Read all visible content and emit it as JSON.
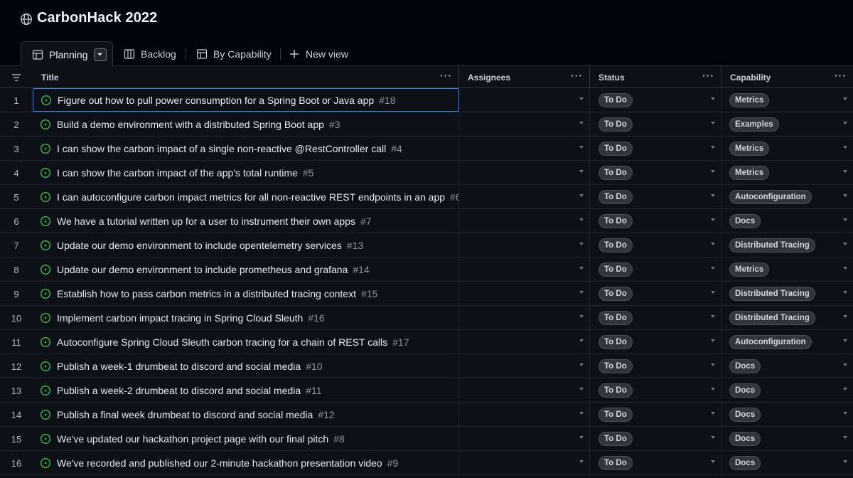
{
  "project": {
    "title": "CarbonHack 2022"
  },
  "tabs": [
    {
      "label": "Planning"
    },
    {
      "label": "Backlog"
    },
    {
      "label": "By Capability"
    },
    {
      "label": "New view"
    }
  ],
  "columns": {
    "title": "Title",
    "assignees": "Assignees",
    "status": "Status",
    "capability": "Capability"
  },
  "rows": [
    {
      "n": "1",
      "title": "Figure out how to pull power consumption for a Spring Boot or Java app",
      "issue": "#18",
      "status": "To Do",
      "capability": "Metrics"
    },
    {
      "n": "2",
      "title": "Build a demo environment with a distributed Spring Boot app",
      "issue": "#3",
      "status": "To Do",
      "capability": "Examples"
    },
    {
      "n": "3",
      "title": "I can show the carbon impact of a single non-reactive @RestController call",
      "issue": "#4",
      "status": "To Do",
      "capability": "Metrics"
    },
    {
      "n": "4",
      "title": "I can show the carbon impact of the app's total runtime",
      "issue": "#5",
      "status": "To Do",
      "capability": "Metrics"
    },
    {
      "n": "5",
      "title": "I can autoconfigure carbon impact metrics for all non-reactive REST endpoints in an app",
      "issue": "#6",
      "status": "To Do",
      "capability": "Autoconfiguration"
    },
    {
      "n": "6",
      "title": "We have a tutorial written up for a user to instrument their own apps",
      "issue": "#7",
      "status": "To Do",
      "capability": "Docs"
    },
    {
      "n": "7",
      "title": "Update our demo environment to include opentelemetry services",
      "issue": "#13",
      "status": "To Do",
      "capability": "Distributed Tracing"
    },
    {
      "n": "8",
      "title": "Update our demo environment to include prometheus and grafana",
      "issue": "#14",
      "status": "To Do",
      "capability": "Metrics"
    },
    {
      "n": "9",
      "title": "Establish how to pass carbon metrics in a distributed tracing context",
      "issue": "#15",
      "status": "To Do",
      "capability": "Distributed Tracing"
    },
    {
      "n": "10",
      "title": "Implement carbon impact tracing in Spring Cloud Sleuth",
      "issue": "#16",
      "status": "To Do",
      "capability": "Distributed Tracing"
    },
    {
      "n": "11",
      "title": "Autoconfigure Spring Cloud Sleuth carbon tracing for a chain of REST calls",
      "issue": "#17",
      "status": "To Do",
      "capability": "Autoconfiguration"
    },
    {
      "n": "12",
      "title": "Publish a week-1 drumbeat to discord and social media",
      "issue": "#10",
      "status": "To Do",
      "capability": "Docs"
    },
    {
      "n": "13",
      "title": "Publish a week-2 drumbeat to discord and social media",
      "issue": "#11",
      "status": "To Do",
      "capability": "Docs"
    },
    {
      "n": "14",
      "title": "Publish a final week drumbeat to discord and social media",
      "issue": "#12",
      "status": "To Do",
      "capability": "Docs"
    },
    {
      "n": "15",
      "title": "We've updated our hackathon project page with our final pitch",
      "issue": "#8",
      "status": "To Do",
      "capability": "Docs"
    },
    {
      "n": "16",
      "title": "We've recorded and published our 2-minute hackathon presentation video",
      "issue": "#9",
      "status": "To Do",
      "capability": "Docs"
    }
  ],
  "colors": {
    "accent": "#3d80e8",
    "open_issue": "#3fb950",
    "background": "#0d1117"
  },
  "icons": [
    "globe-icon",
    "table-icon",
    "board-icon",
    "plus-icon",
    "filter-icon",
    "open-issue-icon",
    "kebab-icon",
    "chevron-down-icon"
  ]
}
